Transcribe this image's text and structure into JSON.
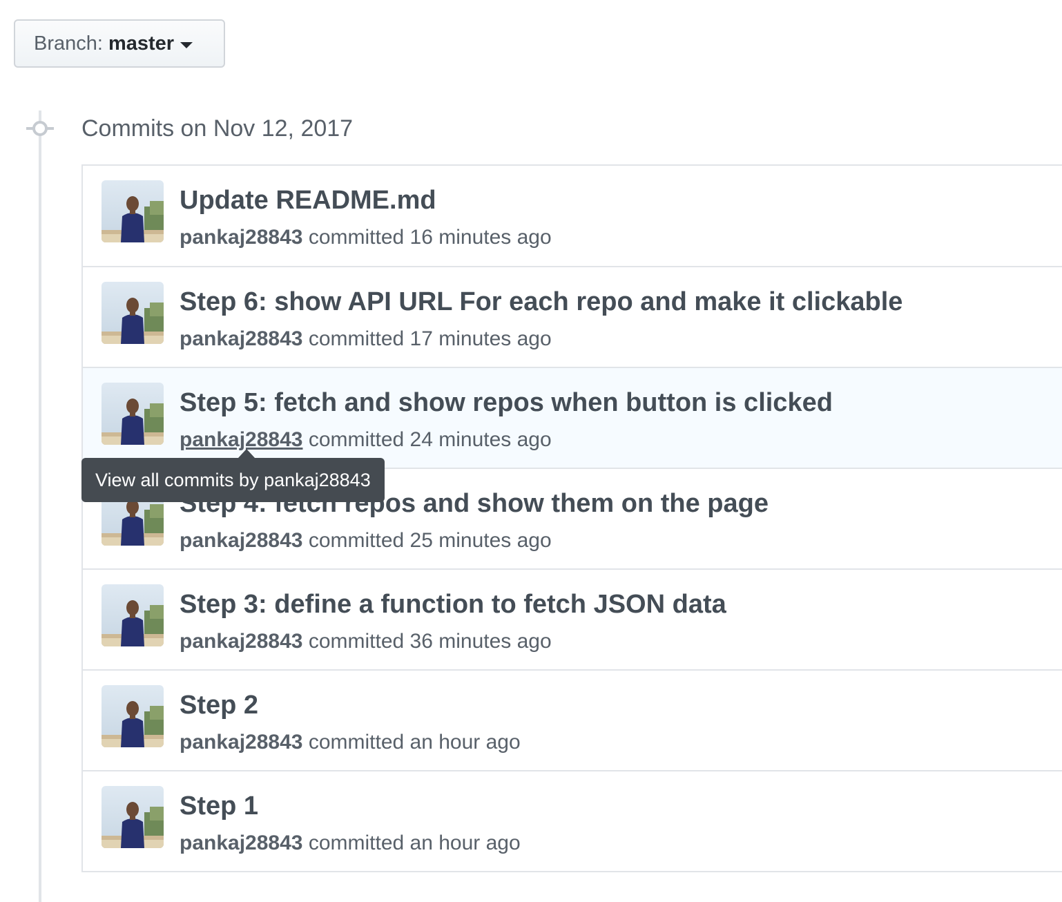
{
  "branch_selector": {
    "label": "Branch:",
    "value": "master"
  },
  "commit_group": {
    "title": "Commits on Nov 12, 2017"
  },
  "commits": [
    {
      "message": "Update README.md",
      "author": "pankaj28843",
      "verb": "committed",
      "time": "16 minutes ago"
    },
    {
      "message": "Step 6: show API URL For each repo and make it clickable",
      "author": "pankaj28843",
      "verb": "committed",
      "time": "17 minutes ago"
    },
    {
      "message": "Step 5: fetch and show repos when button is clicked",
      "author": "pankaj28843",
      "verb": "committed",
      "time": "24 minutes ago"
    },
    {
      "message": "Step 4: fetch repos and show them on the page",
      "author": "pankaj28843",
      "verb": "committed",
      "time": "25 minutes ago"
    },
    {
      "message": "Step 3: define a function to fetch JSON data",
      "author": "pankaj28843",
      "verb": "committed",
      "time": "36 minutes ago"
    },
    {
      "message": "Step 2",
      "author": "pankaj28843",
      "verb": "committed",
      "time": "an hour ago"
    },
    {
      "message": "Step 1",
      "author": "pankaj28843",
      "verb": "committed",
      "time": "an hour ago"
    }
  ],
  "tooltip": {
    "text": "View all commits by pankaj28843"
  },
  "colors": {
    "text_primary": "#24292e",
    "text_secondary": "#586069",
    "border": "#e1e4e8",
    "hover_row": "#f6fbff",
    "tooltip_bg": "#454b51"
  },
  "icons": {
    "caret": "triangle-down-icon",
    "commit_node": "git-commit-icon",
    "avatar": "user-avatar-photo"
  }
}
